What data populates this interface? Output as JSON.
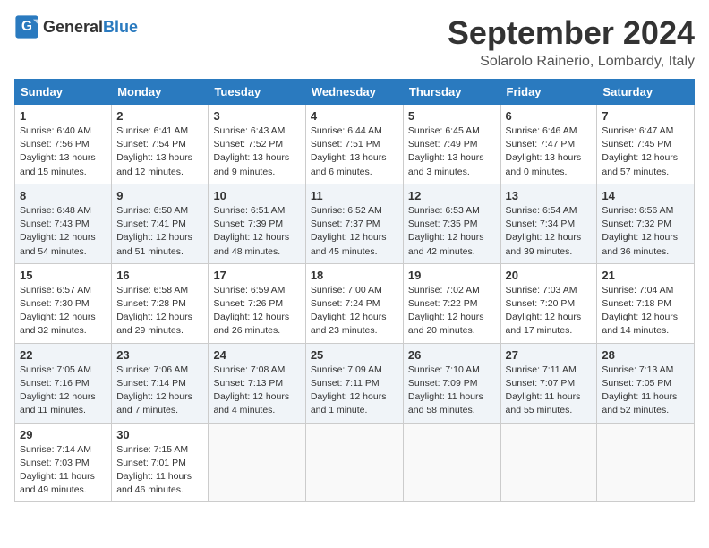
{
  "header": {
    "logo_general": "General",
    "logo_blue": "Blue",
    "month_title": "September 2024",
    "location": "Solarolo Rainerio, Lombardy, Italy"
  },
  "weekdays": [
    "Sunday",
    "Monday",
    "Tuesday",
    "Wednesday",
    "Thursday",
    "Friday",
    "Saturday"
  ],
  "weeks": [
    [
      {
        "day": "1",
        "lines": [
          "Sunrise: 6:40 AM",
          "Sunset: 7:56 PM",
          "Daylight: 13 hours",
          "and 15 minutes."
        ]
      },
      {
        "day": "2",
        "lines": [
          "Sunrise: 6:41 AM",
          "Sunset: 7:54 PM",
          "Daylight: 13 hours",
          "and 12 minutes."
        ]
      },
      {
        "day": "3",
        "lines": [
          "Sunrise: 6:43 AM",
          "Sunset: 7:52 PM",
          "Daylight: 13 hours",
          "and 9 minutes."
        ]
      },
      {
        "day": "4",
        "lines": [
          "Sunrise: 6:44 AM",
          "Sunset: 7:51 PM",
          "Daylight: 13 hours",
          "and 6 minutes."
        ]
      },
      {
        "day": "5",
        "lines": [
          "Sunrise: 6:45 AM",
          "Sunset: 7:49 PM",
          "Daylight: 13 hours",
          "and 3 minutes."
        ]
      },
      {
        "day": "6",
        "lines": [
          "Sunrise: 6:46 AM",
          "Sunset: 7:47 PM",
          "Daylight: 13 hours",
          "and 0 minutes."
        ]
      },
      {
        "day": "7",
        "lines": [
          "Sunrise: 6:47 AM",
          "Sunset: 7:45 PM",
          "Daylight: 12 hours",
          "and 57 minutes."
        ]
      }
    ],
    [
      {
        "day": "8",
        "lines": [
          "Sunrise: 6:48 AM",
          "Sunset: 7:43 PM",
          "Daylight: 12 hours",
          "and 54 minutes."
        ]
      },
      {
        "day": "9",
        "lines": [
          "Sunrise: 6:50 AM",
          "Sunset: 7:41 PM",
          "Daylight: 12 hours",
          "and 51 minutes."
        ]
      },
      {
        "day": "10",
        "lines": [
          "Sunrise: 6:51 AM",
          "Sunset: 7:39 PM",
          "Daylight: 12 hours",
          "and 48 minutes."
        ]
      },
      {
        "day": "11",
        "lines": [
          "Sunrise: 6:52 AM",
          "Sunset: 7:37 PM",
          "Daylight: 12 hours",
          "and 45 minutes."
        ]
      },
      {
        "day": "12",
        "lines": [
          "Sunrise: 6:53 AM",
          "Sunset: 7:35 PM",
          "Daylight: 12 hours",
          "and 42 minutes."
        ]
      },
      {
        "day": "13",
        "lines": [
          "Sunrise: 6:54 AM",
          "Sunset: 7:34 PM",
          "Daylight: 12 hours",
          "and 39 minutes."
        ]
      },
      {
        "day": "14",
        "lines": [
          "Sunrise: 6:56 AM",
          "Sunset: 7:32 PM",
          "Daylight: 12 hours",
          "and 36 minutes."
        ]
      }
    ],
    [
      {
        "day": "15",
        "lines": [
          "Sunrise: 6:57 AM",
          "Sunset: 7:30 PM",
          "Daylight: 12 hours",
          "and 32 minutes."
        ]
      },
      {
        "day": "16",
        "lines": [
          "Sunrise: 6:58 AM",
          "Sunset: 7:28 PM",
          "Daylight: 12 hours",
          "and 29 minutes."
        ]
      },
      {
        "day": "17",
        "lines": [
          "Sunrise: 6:59 AM",
          "Sunset: 7:26 PM",
          "Daylight: 12 hours",
          "and 26 minutes."
        ]
      },
      {
        "day": "18",
        "lines": [
          "Sunrise: 7:00 AM",
          "Sunset: 7:24 PM",
          "Daylight: 12 hours",
          "and 23 minutes."
        ]
      },
      {
        "day": "19",
        "lines": [
          "Sunrise: 7:02 AM",
          "Sunset: 7:22 PM",
          "Daylight: 12 hours",
          "and 20 minutes."
        ]
      },
      {
        "day": "20",
        "lines": [
          "Sunrise: 7:03 AM",
          "Sunset: 7:20 PM",
          "Daylight: 12 hours",
          "and 17 minutes."
        ]
      },
      {
        "day": "21",
        "lines": [
          "Sunrise: 7:04 AM",
          "Sunset: 7:18 PM",
          "Daylight: 12 hours",
          "and 14 minutes."
        ]
      }
    ],
    [
      {
        "day": "22",
        "lines": [
          "Sunrise: 7:05 AM",
          "Sunset: 7:16 PM",
          "Daylight: 12 hours",
          "and 11 minutes."
        ]
      },
      {
        "day": "23",
        "lines": [
          "Sunrise: 7:06 AM",
          "Sunset: 7:14 PM",
          "Daylight: 12 hours",
          "and 7 minutes."
        ]
      },
      {
        "day": "24",
        "lines": [
          "Sunrise: 7:08 AM",
          "Sunset: 7:13 PM",
          "Daylight: 12 hours",
          "and 4 minutes."
        ]
      },
      {
        "day": "25",
        "lines": [
          "Sunrise: 7:09 AM",
          "Sunset: 7:11 PM",
          "Daylight: 12 hours",
          "and 1 minute."
        ]
      },
      {
        "day": "26",
        "lines": [
          "Sunrise: 7:10 AM",
          "Sunset: 7:09 PM",
          "Daylight: 11 hours",
          "and 58 minutes."
        ]
      },
      {
        "day": "27",
        "lines": [
          "Sunrise: 7:11 AM",
          "Sunset: 7:07 PM",
          "Daylight: 11 hours",
          "and 55 minutes."
        ]
      },
      {
        "day": "28",
        "lines": [
          "Sunrise: 7:13 AM",
          "Sunset: 7:05 PM",
          "Daylight: 11 hours",
          "and 52 minutes."
        ]
      }
    ],
    [
      {
        "day": "29",
        "lines": [
          "Sunrise: 7:14 AM",
          "Sunset: 7:03 PM",
          "Daylight: 11 hours",
          "and 49 minutes."
        ]
      },
      {
        "day": "30",
        "lines": [
          "Sunrise: 7:15 AM",
          "Sunset: 7:01 PM",
          "Daylight: 11 hours",
          "and 46 minutes."
        ]
      },
      null,
      null,
      null,
      null,
      null
    ]
  ]
}
